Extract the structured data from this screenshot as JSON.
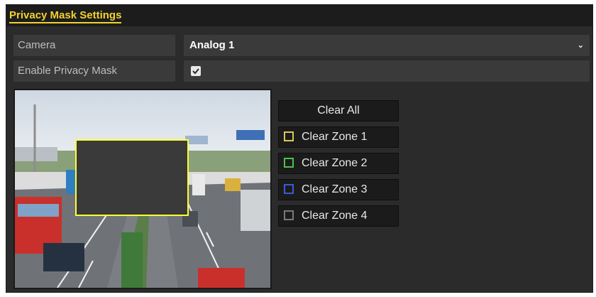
{
  "header": {
    "title": "Privacy Mask Settings"
  },
  "camera": {
    "label": "Camera",
    "value": "Analog 1"
  },
  "enable": {
    "label": "Enable Privacy Mask",
    "checked": true
  },
  "buttons": {
    "clear_all": "Clear All",
    "zones": [
      {
        "label": "Clear Zone 1",
        "color": "#d8c85a"
      },
      {
        "label": "Clear Zone 2",
        "color": "#4cc24c"
      },
      {
        "label": "Clear Zone 3",
        "color": "#3b5bd6"
      },
      {
        "label": "Clear Zone 4",
        "color": "#7a7a7a"
      }
    ]
  },
  "preview": {
    "mask_zone_color": "#ffff33",
    "mask_fill_color": "#3a3a3a"
  }
}
